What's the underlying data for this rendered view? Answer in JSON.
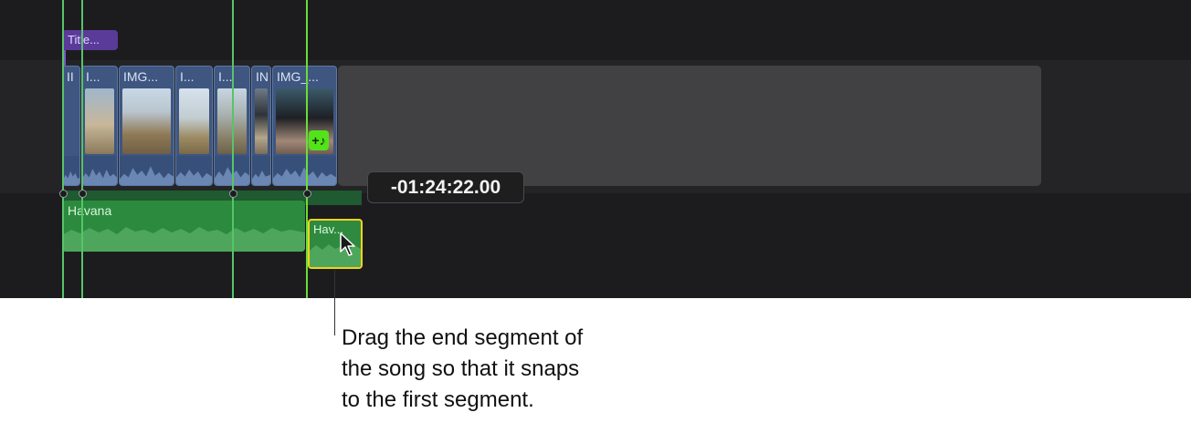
{
  "timeline": {
    "title_clip": {
      "label": "Title..."
    },
    "video_clips": [
      {
        "label": "II",
        "thumb": "th-a"
      },
      {
        "label": "I...",
        "thumb": "th-a"
      },
      {
        "label": "IMG...",
        "thumb": "th-b"
      },
      {
        "label": "I...",
        "thumb": "th-c"
      },
      {
        "label": "I...",
        "thumb": "th-d"
      },
      {
        "label": "IN",
        "thumb": "th-e"
      },
      {
        "label": "IMG_...",
        "thumb": "th-f"
      }
    ],
    "clip_badge_icon": "music-note-add-icon",
    "audio_clip": {
      "label": "Havana",
      "color": "#2b8a3d"
    },
    "end_segment": {
      "label": "Hav...",
      "selection_color": "#f3d21a"
    },
    "timecode_tooltip": "-01:24:22.00",
    "snap_line_color": "#6ddb39",
    "cursor_icon": "pointer-cursor-icon"
  },
  "callout": {
    "lines": [
      "Drag the end segment of",
      "the song so that it snaps",
      "to the first segment."
    ]
  }
}
